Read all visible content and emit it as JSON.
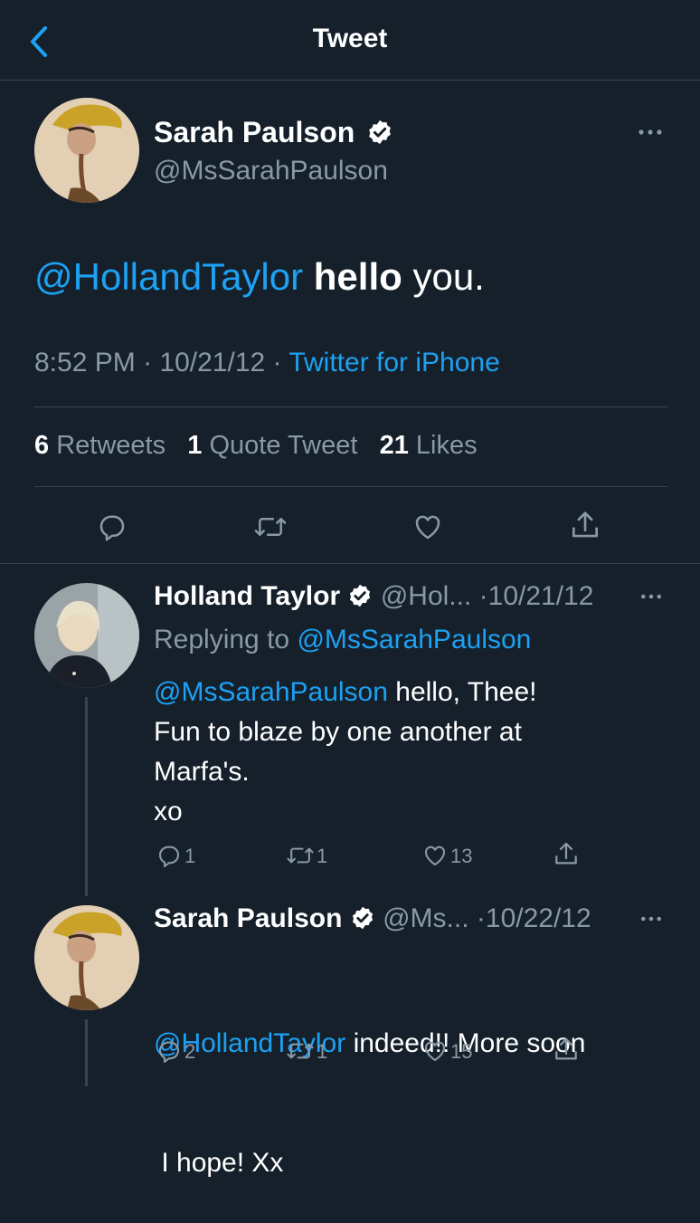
{
  "header": {
    "title": "Tweet"
  },
  "main_tweet": {
    "name": "Sarah Paulson",
    "handle": "@MsSarahPaulson",
    "mention": "@HollandTaylor",
    "text_bold": "hello",
    "text_rest": "you.",
    "time": "8:52 PM",
    "date": "10/21/12",
    "source": "Twitter for iPhone",
    "sep": "·",
    "stats": {
      "retweets_count": "6",
      "retweets_label": "Retweets",
      "quotes_count": "1",
      "quotes_label": "Quote Tweet",
      "likes_count": "21",
      "likes_label": "Likes"
    }
  },
  "replies": [
    {
      "name": "Holland Taylor",
      "handle": "@Hol...",
      "date": "·10/21/12",
      "replying_label": "Replying to",
      "replying_to": "@MsSarahPaulson",
      "mention": "@MsSarahPaulson",
      "line1": "hello, Thee!",
      "line2": "Fun to blaze by one another at",
      "line3": "Marfa's.",
      "line4": "xo",
      "reply_count": "1",
      "retweet_count": "1",
      "like_count": "13"
    },
    {
      "name": "Sarah Paulson",
      "handle": "@Ms...",
      "date": "·10/22/12",
      "mention": "@HollandTaylor",
      "line1": "indeed!! More soon",
      "line2": " I hope! Xx",
      "reply_count": "2",
      "retweet_count": "1",
      "like_count": "15"
    }
  ],
  "colors": {
    "background": "#15202b",
    "accent": "#1da1f2",
    "muted": "#8899a6",
    "border": "#38444d"
  },
  "icons": [
    "back-chevron-icon",
    "verified-badge-icon",
    "more-dots-icon",
    "reply-icon",
    "retweet-icon",
    "like-icon",
    "share-icon"
  ]
}
